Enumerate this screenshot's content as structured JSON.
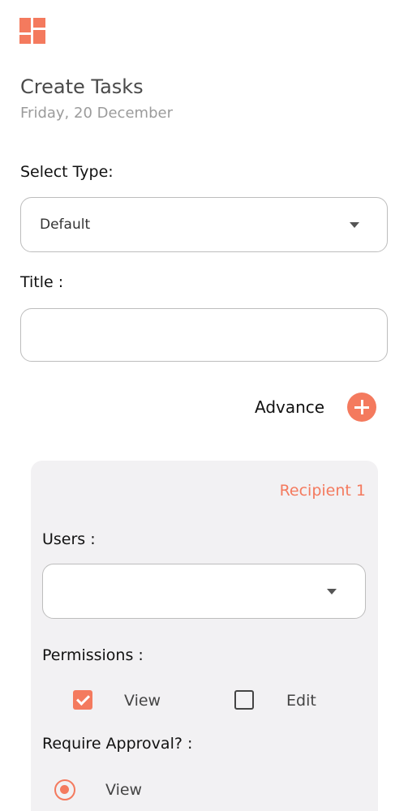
{
  "header": {
    "logo_icon": "dashboard-grid-icon",
    "title": "Create Tasks",
    "date": "Friday, 20 December"
  },
  "form": {
    "type_label": "Select Type:",
    "type_value": "Default",
    "title_label": "Title :",
    "title_value": "",
    "advance_label": "Advance"
  },
  "recipient": {
    "heading": "Recipient 1",
    "users_label": "Users :",
    "users_value": "",
    "permissions_label": "Permissions :",
    "permissions": [
      {
        "label": "View",
        "checked": true
      },
      {
        "label": "Edit",
        "checked": false
      }
    ],
    "approval_label": "Require Approval? :",
    "approval_option": {
      "label": "View",
      "selected": true
    }
  },
  "colors": {
    "accent": "#f47a5e",
    "border": "#bdbdbd",
    "card_bg": "#f2f1f3"
  }
}
